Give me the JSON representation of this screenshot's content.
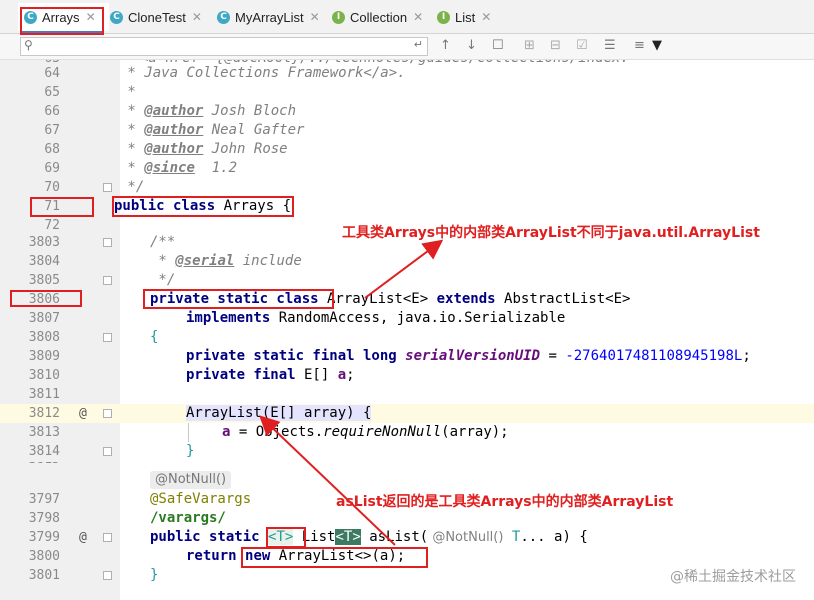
{
  "tabs": [
    {
      "label": "Arrays",
      "icon": "class-icon",
      "icon_letter": "C",
      "color": "#3ea8c6",
      "active": true
    },
    {
      "label": "CloneTest",
      "icon": "class-icon",
      "icon_letter": "C",
      "color": "#3ea8c6",
      "active": false
    },
    {
      "label": "MyArrayList",
      "icon": "class-icon",
      "icon_letter": "C",
      "color": "#3ea8c6",
      "active": false
    },
    {
      "label": "Collection",
      "icon": "interface-icon",
      "icon_letter": "I",
      "color": "#79b34a",
      "active": false
    },
    {
      "label": "List",
      "icon": "interface-icon",
      "icon_letter": "I",
      "color": "#79b34a",
      "active": false
    }
  ],
  "search": {
    "value": "",
    "placeholder": ""
  },
  "top_cut_line": "<a href=\"{@docRoot}/../technotes/guides/collections/index.",
  "lines": {
    "l64": {
      "num": "64",
      "text": " * Java Collections Framework</a>."
    },
    "l65": {
      "num": "65",
      "text": " *"
    },
    "l66": {
      "num": "66",
      "tag": "@author",
      "text": " Josh Bloch"
    },
    "l67": {
      "num": "67",
      "tag": "@author",
      "text": " Neal Gafter"
    },
    "l68": {
      "num": "68",
      "tag": "@author",
      "text": " John Rose"
    },
    "l69": {
      "num": "69",
      "tag": "@since",
      "text": "  1.2"
    },
    "l70": {
      "num": "70",
      "text": " */"
    },
    "l71": {
      "num": "71",
      "kw": "public class",
      "text": " Arrays {"
    },
    "l72": {
      "num": "72",
      "text": ""
    },
    "l3803": {
      "num": "3803",
      "text": "/**"
    },
    "l3804": {
      "num": "3804",
      "tag": "@serial",
      "text": " include"
    },
    "l3805": {
      "num": "3805",
      "text": " */"
    },
    "l3806": {
      "num": "3806",
      "kw": "private static class",
      "text": " ArrayList<E> ",
      "kw2": "extends",
      "text2": " AbstractList<E>"
    },
    "l3807": {
      "num": "3807",
      "kw": "implements",
      "text": " RandomAccess, java.io.Serializable"
    },
    "l3808": {
      "num": "3808",
      "text": "{"
    },
    "l3809": {
      "num": "3809",
      "kw": "private static final long",
      "fld": "serialVersionUID",
      "op": " = ",
      "num_val": "-2764017481108945198L",
      "end": ";"
    },
    "l3810": {
      "num": "3810",
      "kw": "private final",
      "text": " E[] ",
      "fld": "a",
      "end": ";"
    },
    "l3811": {
      "num": "3811",
      "text": ""
    },
    "l3812": {
      "num": "3812",
      "text": "ArrayList(E[] array) {"
    },
    "l3813": {
      "num": "3813",
      "fld": "a",
      "text": " = Objects.",
      "call": "requireNonNull",
      "text2": "(array);"
    },
    "l3814": {
      "num": "3814",
      "text": "}"
    },
    "l_notnull": {
      "text": "@NotNull()"
    },
    "l3797": {
      "num": "3797",
      "text": "@SafeVarargs"
    },
    "l3798": {
      "num": "3798",
      "text": "/varargs/"
    },
    "l3799": {
      "num": "3799",
      "kw": "public static",
      "t1": "<T>",
      "t2": " List",
      "t3": "<T>",
      "name": " asList(",
      "ann": " @NotNull()",
      "t4": " T",
      "t5": "... a) {"
    },
    "l3800": {
      "num": "3800",
      "kw": "return",
      "kw2": "new",
      "text": " ArrayList<>(a);"
    },
    "l3801": {
      "num": "3801",
      "text": "}"
    }
  },
  "annotations": {
    "callout1": "工具类Arrays中的内部类ArrayList不同于java.util.ArrayList",
    "callout2": "asList返回的是工具类Arrays中的内部类ArrayList"
  },
  "gutter_marks": {
    "override1": "@",
    "override2": "@"
  },
  "watermark": "@稀土掘金技术社区",
  "colors": {
    "annotation_red": "#e02020",
    "keyword": "#000080",
    "comment": "#808080",
    "highlight": "#fff9d6"
  }
}
